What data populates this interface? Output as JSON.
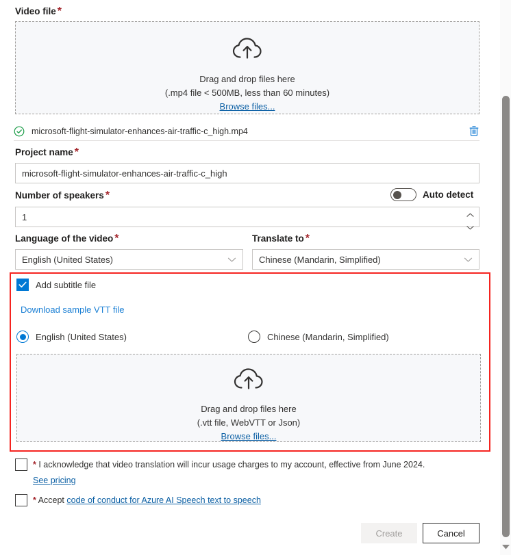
{
  "video_file": {
    "label": "Video file",
    "required_mark": "*",
    "dropzone": {
      "icon": "cloud-upload-icon",
      "line1": "Drag and drop files here",
      "line2": "(.mp4 file < 500MB, less than 60 minutes)",
      "browse_link": "Browse files..."
    },
    "uploaded_file": {
      "status_icon": "check-circle-icon",
      "name": "microsoft-flight-simulator-enhances-air-traffic-c_high.mp4",
      "delete_icon": "trash-icon"
    }
  },
  "project_name": {
    "label": "Project name",
    "required_mark": "*",
    "value": "microsoft-flight-simulator-enhances-air-traffic-c_high",
    "placeholder": ""
  },
  "speakers": {
    "label": "Number of speakers",
    "required_mark": "*",
    "value": "1",
    "auto_detect_label": "Auto detect",
    "auto_detect_on": false,
    "spinner_up_icon": "chevron-up-icon",
    "spinner_down_icon": "chevron-down-icon"
  },
  "language_of_video": {
    "label": "Language of the video",
    "required_mark": "*",
    "selected": "English (United States)",
    "chevron_icon": "chevron-down-icon"
  },
  "translate_to": {
    "label": "Translate to",
    "required_mark": "*",
    "selected": "Chinese (Mandarin, Simplified)",
    "chevron_icon": "chevron-down-icon"
  },
  "subtitle_section": {
    "highlight_color": "#f5231f",
    "checkbox_label": "Add subtitle file",
    "checkbox_checked": true,
    "sample_link": "Download sample VTT file",
    "radios": [
      {
        "label": "English (United States)",
        "selected": true
      },
      {
        "label": "Chinese (Mandarin, Simplified)",
        "selected": false
      }
    ],
    "dropzone": {
      "icon": "cloud-upload-icon",
      "line1": "Drag and drop files here",
      "line2": "(.vtt file, WebVTT or Json)",
      "browse_link": "Browse files..."
    }
  },
  "consents": [
    {
      "checked": false,
      "required_mark": "*",
      "text": "I acknowledge that video translation will incur usage charges to my account, effective from June 2024.",
      "sub_link": "See pricing"
    },
    {
      "checked": false,
      "required_mark": "*",
      "text_before": "Accept",
      "link": "code of conduct for Azure AI Speech text to speech"
    }
  ],
  "actions": {
    "create_label": "Create",
    "create_disabled": true,
    "cancel_label": "Cancel"
  },
  "scrollbar": {
    "arrow_icon": "chevron-down-icon"
  },
  "colors": {
    "accent": "#0078d4",
    "link": "#0b5fa4",
    "required": "#a4262c",
    "highlight": "#f5231f",
    "success": "#1a9c47"
  }
}
